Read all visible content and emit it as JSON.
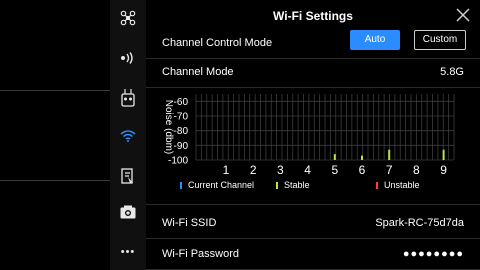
{
  "window": {
    "title": "Wi-Fi Settings"
  },
  "sidebar": {
    "items": [
      {
        "name": "aircraft-icon",
        "glyph": "✣"
      },
      {
        "name": "remote-signal-icon",
        "glyph": "•))"
      },
      {
        "name": "remote-controller-icon",
        "glyph": "▣"
      },
      {
        "name": "wifi-icon",
        "glyph": "≋"
      },
      {
        "name": "battery-icon",
        "glyph": "▰"
      },
      {
        "name": "camera-icon",
        "glyph": "◉"
      },
      {
        "name": "more-icon",
        "glyph": "•••"
      }
    ],
    "active_index": 3
  },
  "channel_control": {
    "label": "Channel Control Mode",
    "auto_label": "Auto",
    "custom_label": "Custom",
    "selected": "Auto"
  },
  "channel_mode": {
    "label": "Channel Mode",
    "value": "5.8G"
  },
  "chart_data": {
    "type": "bar",
    "ylabel": "Noise (dbm)",
    "y_ticks": [
      "-60",
      "-70",
      "-80",
      "-90",
      "-100"
    ],
    "ylim": [
      -100,
      -55
    ],
    "categories": [
      "1",
      "2",
      "3",
      "4",
      "5",
      "6",
      "7",
      "8",
      "9"
    ],
    "series": [
      {
        "name": "Stable",
        "color": "#b6e34a",
        "values": [
          null,
          null,
          null,
          null,
          -96,
          -97,
          -93,
          null,
          -93
        ]
      }
    ],
    "legend": [
      {
        "label": "Current Channel",
        "color": "#2a8cff"
      },
      {
        "label": "Stable",
        "color": "#b6e34a"
      },
      {
        "label": "Unstable",
        "color": "#ff3b3b"
      }
    ],
    "grid": true
  },
  "ssid": {
    "label": "Wi-Fi SSID",
    "value": "Spark-RC-75d7da"
  },
  "password": {
    "label": "Wi-Fi Password",
    "value": "●●●●●●●●"
  },
  "colors": {
    "accent": "#2a8cff",
    "stable": "#b6e34a",
    "unstable": "#ff3b3b"
  }
}
